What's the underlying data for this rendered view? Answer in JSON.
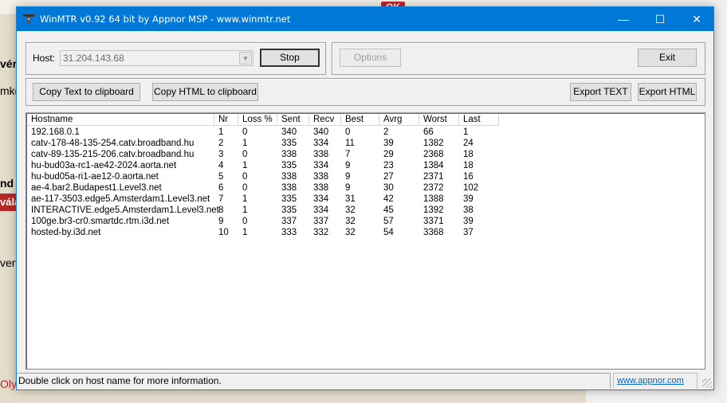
{
  "background": {
    "ok_button": "OK",
    "fragments": [
      "vér",
      "mko",
      "nd",
      "vála",
      "vert",
      "Oly"
    ]
  },
  "window": {
    "title": "WinMTR v0.92 64 bit by Appnor MSP - www.winmtr.net",
    "controls": {
      "minimize": "—",
      "maximize": "☐",
      "close": "✕"
    }
  },
  "host": {
    "label": "Host:",
    "value": "31.204.143.68"
  },
  "buttons": {
    "stop": "Stop",
    "options": "Options",
    "exit": "Exit",
    "copy_text": "Copy Text to clipboard",
    "copy_html": "Copy HTML to clipboard",
    "export_text": "Export TEXT",
    "export_html": "Export HTML"
  },
  "table": {
    "columns": [
      "Hostname",
      "Nr",
      "Loss %",
      "Sent",
      "Recv",
      "Best",
      "Avrg",
      "Worst",
      "Last"
    ],
    "rows": [
      [
        "192.168.0.1",
        "1",
        "0",
        "340",
        "340",
        "0",
        "2",
        "66",
        "1"
      ],
      [
        "catv-178-48-135-254.catv.broadband.hu",
        "2",
        "1",
        "335",
        "334",
        "11",
        "39",
        "1382",
        "24"
      ],
      [
        "catv-89-135-215-206.catv.broadband.hu",
        "3",
        "0",
        "338",
        "338",
        "7",
        "29",
        "2368",
        "18"
      ],
      [
        "hu-bud03a-rc1-ae42-2024.aorta.net",
        "4",
        "1",
        "335",
        "334",
        "9",
        "23",
        "1384",
        "18"
      ],
      [
        "hu-bud05a-ri1-ae12-0.aorta.net",
        "5",
        "0",
        "338",
        "338",
        "9",
        "27",
        "2371",
        "16"
      ],
      [
        "ae-4.bar2.Budapest1.Level3.net",
        "6",
        "0",
        "338",
        "338",
        "9",
        "30",
        "2372",
        "102"
      ],
      [
        "ae-117-3503.edge5.Amsterdam1.Level3.net",
        "7",
        "1",
        "335",
        "334",
        "31",
        "42",
        "1388",
        "39"
      ],
      [
        "INTERACTIVE.edge5.Amsterdam1.Level3.net",
        "8",
        "1",
        "335",
        "334",
        "32",
        "45",
        "1392",
        "38"
      ],
      [
        "100ge.br3-cr0.smartdc.rtm.i3d.net",
        "9",
        "0",
        "337",
        "337",
        "32",
        "57",
        "3371",
        "39"
      ],
      [
        "hosted-by.i3d.net",
        "10",
        "1",
        "333",
        "332",
        "32",
        "54",
        "3368",
        "37"
      ]
    ]
  },
  "status": {
    "message": "Double click on host name for more information.",
    "link": "www.appnor.com"
  }
}
